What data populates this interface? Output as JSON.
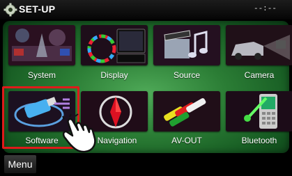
{
  "header": {
    "title": "SET-UP",
    "clock": "--:--"
  },
  "tiles": [
    {
      "label": "System"
    },
    {
      "label": "Display"
    },
    {
      "label": "Source"
    },
    {
      "label": "Camera"
    },
    {
      "label": "Software"
    },
    {
      "label": "Navigation"
    },
    {
      "label": "AV-OUT"
    },
    {
      "label": "Bluetooth"
    }
  ],
  "footer": {
    "menu_label": "Menu"
  },
  "colors": {
    "panel": "#2b7d35",
    "selection": "#e01a1a"
  }
}
